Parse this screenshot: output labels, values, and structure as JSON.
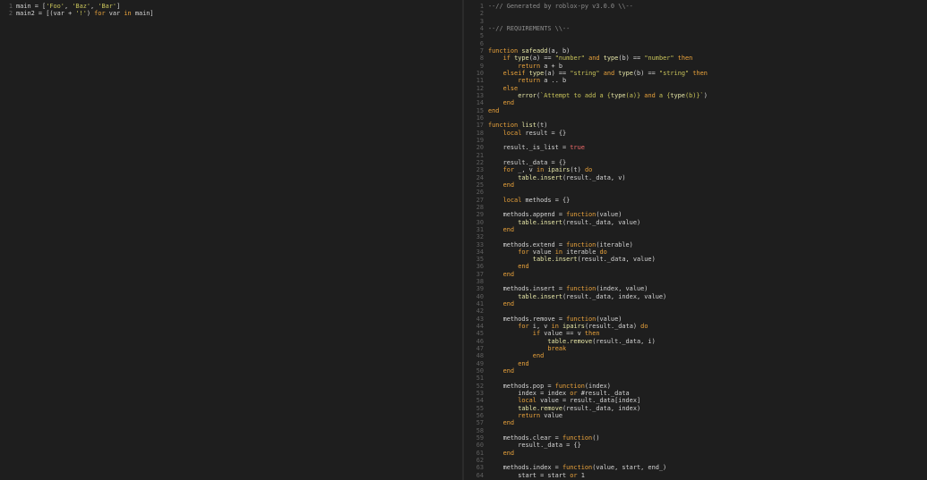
{
  "colors": {
    "background": "#1e1e1e",
    "text": "#d4d4d4",
    "line_number": "#5f5f5f",
    "keyword": "#e9a23b",
    "string": "#c8c35a",
    "function": "#e7e7a8",
    "boolean": "#f06a6a",
    "comment": "#8d8d8d"
  },
  "left_editor": {
    "lines": [
      {
        "n": "1",
        "tokens": [
          {
            "c": "text",
            "t": "main = ["
          },
          {
            "c": "str",
            "t": "'Foo'"
          },
          {
            "c": "text",
            "t": ", "
          },
          {
            "c": "str",
            "t": "'Baz'"
          },
          {
            "c": "text",
            "t": ", "
          },
          {
            "c": "str",
            "t": "'Bar'"
          },
          {
            "c": "text",
            "t": "]"
          }
        ]
      },
      {
        "n": "2",
        "tokens": [
          {
            "c": "text",
            "t": "main2 = [(var + "
          },
          {
            "c": "str",
            "t": "'!'"
          },
          {
            "c": "text",
            "t": ") "
          },
          {
            "c": "kw",
            "t": "for"
          },
          {
            "c": "text",
            "t": " var "
          },
          {
            "c": "kw",
            "t": "in"
          },
          {
            "c": "text",
            "t": " main]"
          }
        ]
      }
    ]
  },
  "right_editor": {
    "lines": [
      {
        "n": "1",
        "tokens": [
          {
            "c": "cmt",
            "t": "--// Generated by roblox-py v3.0.0 \\\\--"
          }
        ]
      },
      {
        "n": "2",
        "tokens": []
      },
      {
        "n": "3",
        "tokens": []
      },
      {
        "n": "4",
        "tokens": [
          {
            "c": "cmt",
            "t": "--// REQUIREMENTS \\\\--"
          }
        ]
      },
      {
        "n": "5",
        "tokens": []
      },
      {
        "n": "6",
        "tokens": []
      },
      {
        "n": "7",
        "tokens": [
          {
            "c": "kw",
            "t": "function"
          },
          {
            "c": "text",
            "t": " "
          },
          {
            "c": "fn",
            "t": "safeadd"
          },
          {
            "c": "text",
            "t": "(a, b)"
          }
        ]
      },
      {
        "n": "8",
        "tokens": [
          {
            "c": "text",
            "t": "    "
          },
          {
            "c": "kw",
            "t": "if"
          },
          {
            "c": "text",
            "t": " "
          },
          {
            "c": "fn",
            "t": "type"
          },
          {
            "c": "text",
            "t": "(a) == "
          },
          {
            "c": "str",
            "t": "\"number\""
          },
          {
            "c": "text",
            "t": " "
          },
          {
            "c": "kw",
            "t": "and"
          },
          {
            "c": "text",
            "t": " "
          },
          {
            "c": "fn",
            "t": "type"
          },
          {
            "c": "text",
            "t": "(b) == "
          },
          {
            "c": "str",
            "t": "\"number\""
          },
          {
            "c": "text",
            "t": " "
          },
          {
            "c": "kw",
            "t": "then"
          }
        ]
      },
      {
        "n": "9",
        "tokens": [
          {
            "c": "text",
            "t": "        "
          },
          {
            "c": "kw",
            "t": "return"
          },
          {
            "c": "text",
            "t": " a + b"
          }
        ]
      },
      {
        "n": "10",
        "tokens": [
          {
            "c": "text",
            "t": "    "
          },
          {
            "c": "kw",
            "t": "elseif"
          },
          {
            "c": "text",
            "t": " "
          },
          {
            "c": "fn",
            "t": "type"
          },
          {
            "c": "text",
            "t": "(a) == "
          },
          {
            "c": "str",
            "t": "\"string\""
          },
          {
            "c": "text",
            "t": " "
          },
          {
            "c": "kw",
            "t": "and"
          },
          {
            "c": "text",
            "t": " "
          },
          {
            "c": "fn",
            "t": "type"
          },
          {
            "c": "text",
            "t": "(b) == "
          },
          {
            "c": "str",
            "t": "\"string\""
          },
          {
            "c": "text",
            "t": " "
          },
          {
            "c": "kw",
            "t": "then"
          }
        ]
      },
      {
        "n": "11",
        "tokens": [
          {
            "c": "text",
            "t": "        "
          },
          {
            "c": "kw",
            "t": "return"
          },
          {
            "c": "text",
            "t": " a .. b"
          }
        ]
      },
      {
        "n": "12",
        "tokens": [
          {
            "c": "text",
            "t": "    "
          },
          {
            "c": "kw",
            "t": "else"
          }
        ]
      },
      {
        "n": "13",
        "tokens": [
          {
            "c": "text",
            "t": "        "
          },
          {
            "c": "fn",
            "t": "error"
          },
          {
            "c": "text",
            "t": "("
          },
          {
            "c": "str",
            "t": "`Attempt to add a {"
          },
          {
            "c": "fn",
            "t": "type"
          },
          {
            "c": "str",
            "t": "(a)} "
          },
          {
            "c": "kw",
            "t": "and"
          },
          {
            "c": "str",
            "t": " a {"
          },
          {
            "c": "fn",
            "t": "type"
          },
          {
            "c": "str",
            "t": "(b)}`"
          },
          {
            "c": "text",
            "t": ")"
          }
        ]
      },
      {
        "n": "14",
        "tokens": [
          {
            "c": "text",
            "t": "    "
          },
          {
            "c": "kw",
            "t": "end"
          }
        ]
      },
      {
        "n": "15",
        "tokens": [
          {
            "c": "kw",
            "t": "end"
          }
        ]
      },
      {
        "n": "16",
        "tokens": []
      },
      {
        "n": "17",
        "tokens": [
          {
            "c": "kw",
            "t": "function"
          },
          {
            "c": "text",
            "t": " "
          },
          {
            "c": "fn",
            "t": "list"
          },
          {
            "c": "text",
            "t": "(t)"
          }
        ]
      },
      {
        "n": "18",
        "tokens": [
          {
            "c": "text",
            "t": "    "
          },
          {
            "c": "kw",
            "t": "local"
          },
          {
            "c": "text",
            "t": " result = {}"
          }
        ]
      },
      {
        "n": "19",
        "tokens": []
      },
      {
        "n": "20",
        "tokens": [
          {
            "c": "text",
            "t": "    result._is_list = "
          },
          {
            "c": "bool",
            "t": "true"
          }
        ]
      },
      {
        "n": "21",
        "tokens": []
      },
      {
        "n": "22",
        "tokens": [
          {
            "c": "text",
            "t": "    result._data = {}"
          }
        ]
      },
      {
        "n": "23",
        "tokens": [
          {
            "c": "text",
            "t": "    "
          },
          {
            "c": "kw",
            "t": "for"
          },
          {
            "c": "text",
            "t": " _, v "
          },
          {
            "c": "kw",
            "t": "in"
          },
          {
            "c": "text",
            "t": " "
          },
          {
            "c": "fn",
            "t": "ipairs"
          },
          {
            "c": "text",
            "t": "(t) "
          },
          {
            "c": "kw",
            "t": "do"
          }
        ]
      },
      {
        "n": "24",
        "tokens": [
          {
            "c": "text",
            "t": "        "
          },
          {
            "c": "fn",
            "t": "table.insert"
          },
          {
            "c": "text",
            "t": "(result._data, v)"
          }
        ]
      },
      {
        "n": "25",
        "tokens": [
          {
            "c": "text",
            "t": "    "
          },
          {
            "c": "kw",
            "t": "end"
          }
        ]
      },
      {
        "n": "26",
        "tokens": []
      },
      {
        "n": "27",
        "tokens": [
          {
            "c": "text",
            "t": "    "
          },
          {
            "c": "kw",
            "t": "local"
          },
          {
            "c": "text",
            "t": " methods = {}"
          }
        ]
      },
      {
        "n": "28",
        "tokens": []
      },
      {
        "n": "29",
        "tokens": [
          {
            "c": "text",
            "t": "    methods.append = "
          },
          {
            "c": "kw",
            "t": "function"
          },
          {
            "c": "text",
            "t": "(value)"
          }
        ]
      },
      {
        "n": "30",
        "tokens": [
          {
            "c": "text",
            "t": "        "
          },
          {
            "c": "fn",
            "t": "table.insert"
          },
          {
            "c": "text",
            "t": "(result._data, value)"
          }
        ]
      },
      {
        "n": "31",
        "tokens": [
          {
            "c": "text",
            "t": "    "
          },
          {
            "c": "kw",
            "t": "end"
          }
        ]
      },
      {
        "n": "32",
        "tokens": []
      },
      {
        "n": "33",
        "tokens": [
          {
            "c": "text",
            "t": "    methods.extend = "
          },
          {
            "c": "kw",
            "t": "function"
          },
          {
            "c": "text",
            "t": "(iterable)"
          }
        ]
      },
      {
        "n": "34",
        "tokens": [
          {
            "c": "text",
            "t": "        "
          },
          {
            "c": "kw",
            "t": "for"
          },
          {
            "c": "text",
            "t": " value "
          },
          {
            "c": "kw",
            "t": "in"
          },
          {
            "c": "text",
            "t": " iterable "
          },
          {
            "c": "kw",
            "t": "do"
          }
        ]
      },
      {
        "n": "35",
        "tokens": [
          {
            "c": "text",
            "t": "            "
          },
          {
            "c": "fn",
            "t": "table.insert"
          },
          {
            "c": "text",
            "t": "(result._data, value)"
          }
        ]
      },
      {
        "n": "36",
        "tokens": [
          {
            "c": "text",
            "t": "        "
          },
          {
            "c": "kw",
            "t": "end"
          }
        ]
      },
      {
        "n": "37",
        "tokens": [
          {
            "c": "text",
            "t": "    "
          },
          {
            "c": "kw",
            "t": "end"
          }
        ]
      },
      {
        "n": "38",
        "tokens": []
      },
      {
        "n": "39",
        "tokens": [
          {
            "c": "text",
            "t": "    methods.insert = "
          },
          {
            "c": "kw",
            "t": "function"
          },
          {
            "c": "text",
            "t": "(index, value)"
          }
        ]
      },
      {
        "n": "40",
        "tokens": [
          {
            "c": "text",
            "t": "        "
          },
          {
            "c": "fn",
            "t": "table.insert"
          },
          {
            "c": "text",
            "t": "(result._data, index, value)"
          }
        ]
      },
      {
        "n": "41",
        "tokens": [
          {
            "c": "text",
            "t": "    "
          },
          {
            "c": "kw",
            "t": "end"
          }
        ]
      },
      {
        "n": "42",
        "tokens": []
      },
      {
        "n": "43",
        "tokens": [
          {
            "c": "text",
            "t": "    methods.remove = "
          },
          {
            "c": "kw",
            "t": "function"
          },
          {
            "c": "text",
            "t": "(value)"
          }
        ]
      },
      {
        "n": "44",
        "tokens": [
          {
            "c": "text",
            "t": "        "
          },
          {
            "c": "kw",
            "t": "for"
          },
          {
            "c": "text",
            "t": " i, v "
          },
          {
            "c": "kw",
            "t": "in"
          },
          {
            "c": "text",
            "t": " "
          },
          {
            "c": "fn",
            "t": "ipairs"
          },
          {
            "c": "text",
            "t": "(result._data) "
          },
          {
            "c": "kw",
            "t": "do"
          }
        ]
      },
      {
        "n": "45",
        "tokens": [
          {
            "c": "text",
            "t": "            "
          },
          {
            "c": "kw",
            "t": "if"
          },
          {
            "c": "text",
            "t": " value == v "
          },
          {
            "c": "kw",
            "t": "then"
          }
        ]
      },
      {
        "n": "46",
        "tokens": [
          {
            "c": "text",
            "t": "                "
          },
          {
            "c": "fn",
            "t": "table.remove"
          },
          {
            "c": "text",
            "t": "(result._data, i)"
          }
        ]
      },
      {
        "n": "47",
        "tokens": [
          {
            "c": "text",
            "t": "                "
          },
          {
            "c": "kw",
            "t": "break"
          }
        ]
      },
      {
        "n": "48",
        "tokens": [
          {
            "c": "text",
            "t": "            "
          },
          {
            "c": "kw",
            "t": "end"
          }
        ]
      },
      {
        "n": "49",
        "tokens": [
          {
            "c": "text",
            "t": "        "
          },
          {
            "c": "kw",
            "t": "end"
          }
        ]
      },
      {
        "n": "50",
        "tokens": [
          {
            "c": "text",
            "t": "    "
          },
          {
            "c": "kw",
            "t": "end"
          }
        ]
      },
      {
        "n": "51",
        "tokens": []
      },
      {
        "n": "52",
        "tokens": [
          {
            "c": "text",
            "t": "    methods.pop = "
          },
          {
            "c": "kw",
            "t": "function"
          },
          {
            "c": "text",
            "t": "(index)"
          }
        ]
      },
      {
        "n": "53",
        "tokens": [
          {
            "c": "text",
            "t": "        index = index "
          },
          {
            "c": "kw",
            "t": "or"
          },
          {
            "c": "text",
            "t": " #result._data"
          }
        ]
      },
      {
        "n": "54",
        "tokens": [
          {
            "c": "text",
            "t": "        "
          },
          {
            "c": "kw",
            "t": "local"
          },
          {
            "c": "text",
            "t": " value = result._data[index]"
          }
        ]
      },
      {
        "n": "55",
        "tokens": [
          {
            "c": "text",
            "t": "        "
          },
          {
            "c": "fn",
            "t": "table.remove"
          },
          {
            "c": "text",
            "t": "(result._data, index)"
          }
        ]
      },
      {
        "n": "56",
        "tokens": [
          {
            "c": "text",
            "t": "        "
          },
          {
            "c": "kw",
            "t": "return"
          },
          {
            "c": "text",
            "t": " value"
          }
        ]
      },
      {
        "n": "57",
        "tokens": [
          {
            "c": "text",
            "t": "    "
          },
          {
            "c": "kw",
            "t": "end"
          }
        ]
      },
      {
        "n": "58",
        "tokens": []
      },
      {
        "n": "59",
        "tokens": [
          {
            "c": "text",
            "t": "    methods.clear = "
          },
          {
            "c": "kw",
            "t": "function"
          },
          {
            "c": "text",
            "t": "()"
          }
        ]
      },
      {
        "n": "60",
        "tokens": [
          {
            "c": "text",
            "t": "        result._data = {}"
          }
        ]
      },
      {
        "n": "61",
        "tokens": [
          {
            "c": "text",
            "t": "    "
          },
          {
            "c": "kw",
            "t": "end"
          }
        ]
      },
      {
        "n": "62",
        "tokens": []
      },
      {
        "n": "63",
        "tokens": [
          {
            "c": "text",
            "t": "    methods.index = "
          },
          {
            "c": "kw",
            "t": "function"
          },
          {
            "c": "text",
            "t": "(value, start, end_)"
          }
        ]
      },
      {
        "n": "64",
        "tokens": [
          {
            "c": "text",
            "t": "        start = start "
          },
          {
            "c": "kw",
            "t": "or"
          },
          {
            "c": "text",
            "t": " 1"
          }
        ]
      }
    ]
  }
}
